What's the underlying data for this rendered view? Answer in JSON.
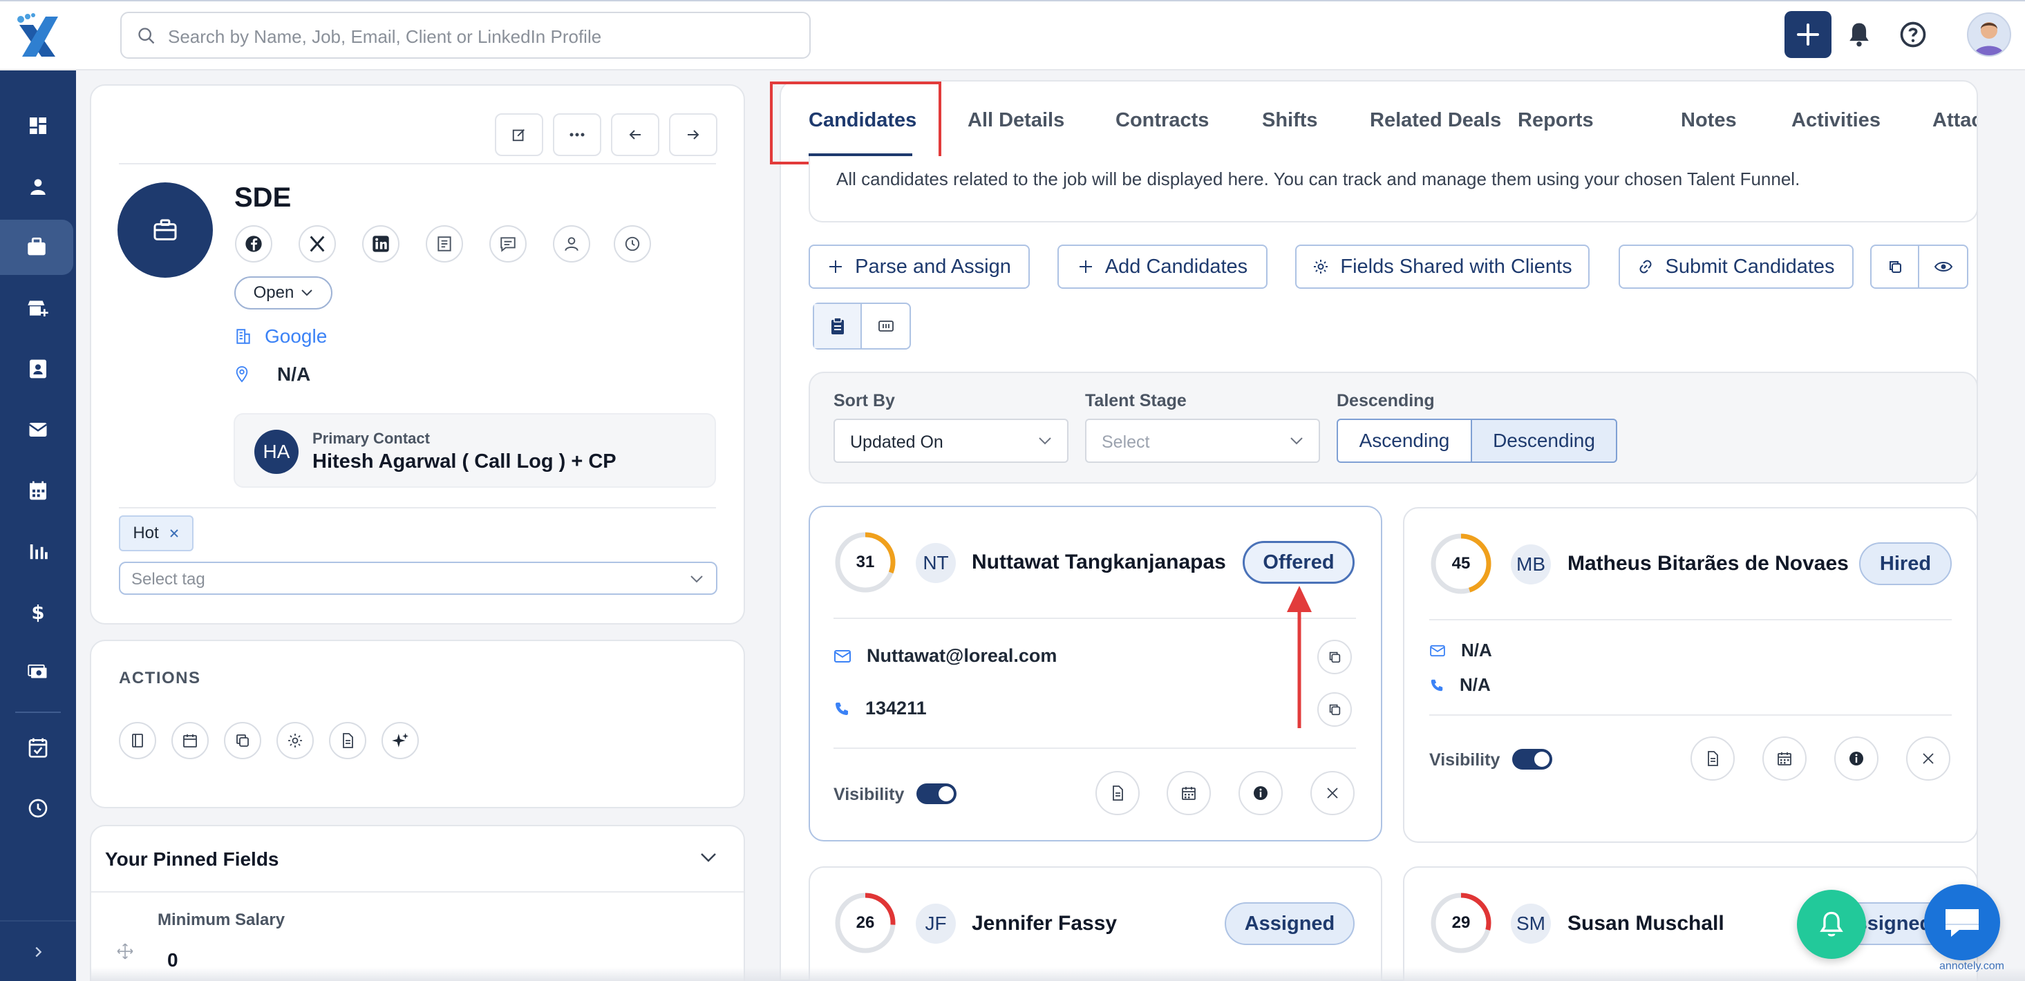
{
  "header": {
    "search_placeholder": "Search by Name, Job, Email, Client or LinkedIn Profile"
  },
  "sidebar": {
    "items": [
      "dashboard",
      "candidates",
      "jobs",
      "deals",
      "contacts",
      "email",
      "calendar",
      "reports",
      "billing",
      "payroll",
      "tasks",
      "timesheet"
    ],
    "active": "jobs"
  },
  "job": {
    "title": "SDE",
    "status": "Open",
    "company": "Google",
    "location": "N/A",
    "primary_contact_label": "Primary Contact",
    "primary_contact_initials": "HA",
    "primary_contact_name": "Hitesh Agarwal ( Call Log ) + CP",
    "tag": "Hot",
    "tag_placeholder": "Select tag"
  },
  "actions": {
    "title": "ACTIONS"
  },
  "pinned": {
    "title": "Your Pinned Fields",
    "field_label": "Minimum Salary",
    "field_value": "0"
  },
  "tabs": [
    "Candidates",
    "All Details",
    "Contracts",
    "Shifts",
    "Related Deals",
    "Reports",
    "Notes",
    "Activities",
    "Attac"
  ],
  "active_tab": "Candidates",
  "info_text": "All candidates related to the job will be displayed here. You can track and manage them using your chosen Talent Funnel.",
  "toolbar": {
    "parse": "Parse and Assign",
    "add": "Add Candidates",
    "fields_shared": "Fields Shared with Clients",
    "submit": "Submit Candidates"
  },
  "sort": {
    "sort_by_label": "Sort By",
    "sort_by_value": "Updated On",
    "stage_label": "Talent Stage",
    "stage_placeholder": "Select",
    "order_label": "Descending",
    "asc": "Ascending",
    "desc": "Descending"
  },
  "candidates": [
    {
      "score": "31",
      "initials": "NT",
      "name": "Nuttawat Tangkanjanapas",
      "stage": "Offered",
      "email": "Nuttawat@loreal.com",
      "phone": "134211",
      "visibility_label": "Visibility",
      "ring_color": "#f0a01c",
      "score_pct": 31
    },
    {
      "score": "45",
      "initials": "MB",
      "name": "Matheus Bitarães de Novaes",
      "stage": "Hired",
      "email": "N/A",
      "phone": "N/A",
      "visibility_label": "Visibility",
      "ring_color": "#f0a01c",
      "score_pct": 45
    },
    {
      "score": "26",
      "initials": "JF",
      "name": "Jennifer Fassy",
      "stage": "Assigned",
      "ring_color": "#e03535",
      "score_pct": 26
    },
    {
      "score": "29",
      "initials": "SM",
      "name": "Susan Muschall",
      "stage": "Assigned",
      "ring_color": "#e03535",
      "score_pct": 29
    }
  ],
  "watermark": "annotely.com"
}
